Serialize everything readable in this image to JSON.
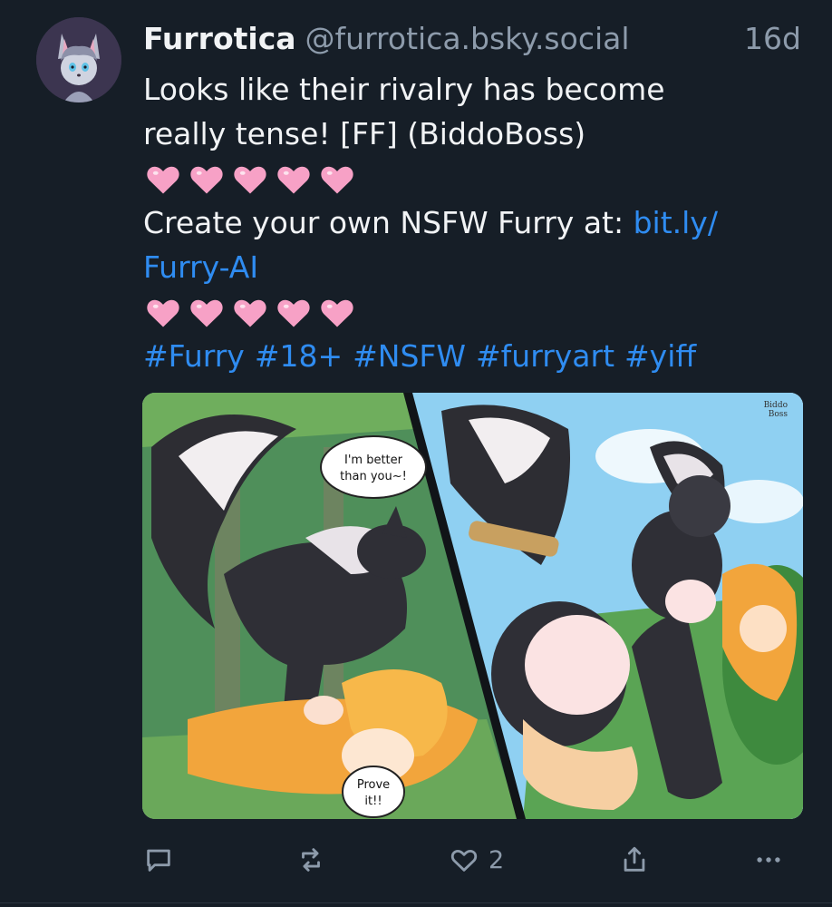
{
  "post": {
    "author": {
      "display_name": "Furrotica",
      "handle": "@furrotica.bsky.social",
      "avatar_icon": "furry-avatar"
    },
    "timestamp": "16d",
    "text": {
      "line1": "Looks like their rivalry has become",
      "line2": "really tense! [FF] (BiddoBoss)",
      "hearts_count": 5,
      "cta_prefix": "Create your own NSFW Furry at: ",
      "link_part1": "bit.ly/",
      "link_part2": "Furry-AI",
      "hashtags": [
        "#Furry",
        "#18+",
        "#NSFW",
        "#furryart",
        "#yiff"
      ]
    },
    "media": {
      "speech_bubble_1": "I'm better than you~!",
      "speech_bubble_2": "Prove it!!",
      "signature": "Biddo Boss"
    },
    "actions": {
      "reply_icon": "reply-icon",
      "repost_icon": "repost-icon",
      "like_icon": "heart-icon",
      "like_count": "2",
      "share_icon": "share-icon",
      "more_icon": "more-icon"
    }
  },
  "colors": {
    "background": "#161e27",
    "text": "#f1f3f5",
    "muted": "#8d9bab",
    "link": "#2f8cf1",
    "heart": "#f7a1c6"
  }
}
